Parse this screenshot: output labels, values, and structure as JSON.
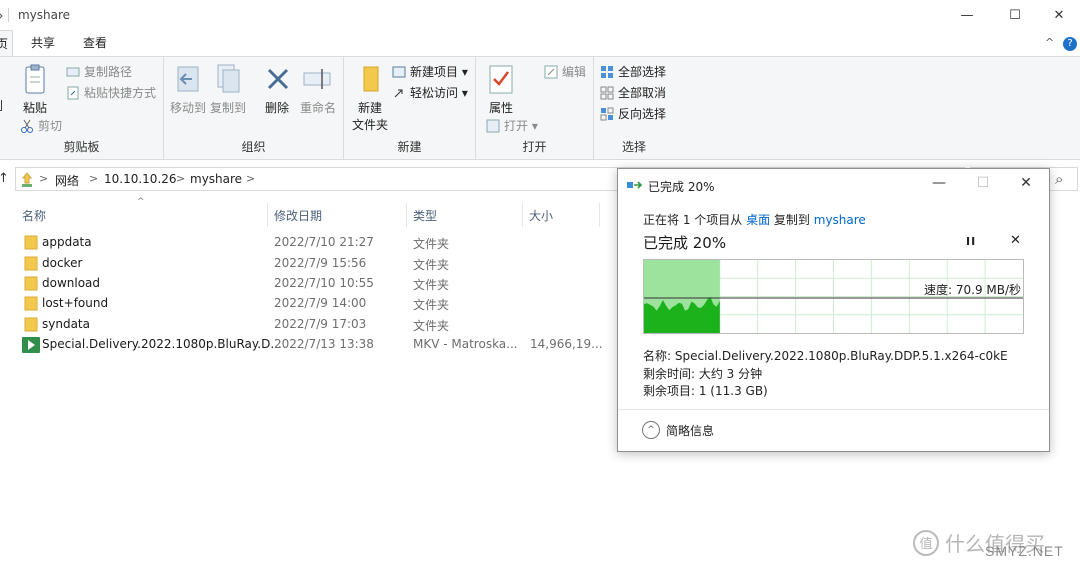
{
  "window": {
    "title": "myshare",
    "min": "—",
    "max": "☐",
    "close": "✕"
  },
  "tabs": {
    "file": "页",
    "share": "共享",
    "view": "查看",
    "collapse": "^",
    "help": "?"
  },
  "ribbon": {
    "clipboard": {
      "label": "剪贴板",
      "pin": "到",
      "paste": "粘贴",
      "copy_path": "复制路径",
      "paste_shortcut": "粘贴快捷方式",
      "cut": "剪切"
    },
    "organize": {
      "label": "组织",
      "move_to": "移动到",
      "copy_to": "复制到",
      "delete": "删除",
      "rename": "重命名"
    },
    "new": {
      "label": "新建",
      "new_folder_l1": "新建",
      "new_folder_l2": "文件夹",
      "new_item": "新建项目 ▾",
      "easy_access": "轻松访问 ▾"
    },
    "open": {
      "label": "打开",
      "properties": "属性",
      "open": "打开 ▾",
      "edit": "编辑"
    },
    "select": {
      "label": "选择",
      "select_all": "全部选择",
      "select_none": "全部取消",
      "invert": "反向选择"
    }
  },
  "address": {
    "up": "↑",
    "crumbs": [
      "网络",
      "10.10.10.26",
      "myshare"
    ],
    "chevrons": [
      ">",
      ">",
      ">",
      ">"
    ],
    "search_icon": "⌕"
  },
  "columns": {
    "name": "名称",
    "date": "修改日期",
    "type": "类型",
    "size": "大小",
    "sort": "^"
  },
  "files": [
    {
      "name": "appdata",
      "date": "2022/7/10 21:27",
      "type": "文件夹",
      "size": "",
      "icon": "folder-icon"
    },
    {
      "name": "docker",
      "date": "2022/7/9 15:56",
      "type": "文件夹",
      "size": "",
      "icon": "folder-icon"
    },
    {
      "name": "download",
      "date": "2022/7/10 10:55",
      "type": "文件夹",
      "size": "",
      "icon": "folder-icon"
    },
    {
      "name": "lost+found",
      "date": "2022/7/9 14:00",
      "type": "文件夹",
      "size": "",
      "icon": "folder-icon"
    },
    {
      "name": "syndata",
      "date": "2022/7/9 17:03",
      "type": "文件夹",
      "size": "",
      "icon": "folder-icon"
    },
    {
      "name": "Special.Delivery.2022.1080p.BluRay.D...",
      "date": "2022/7/13 13:38",
      "type": "MKV - Matroska...",
      "size": "14,966,19...",
      "icon": "mkv-file-icon"
    }
  ],
  "dialog": {
    "title": "已完成 20%",
    "min": "—",
    "max": "☐",
    "close": "✕",
    "line_prefix": "正在将 1 个项目从 ",
    "source": "桌面",
    "line_mid": " 复制到 ",
    "dest": "myshare",
    "progress_text": "已完成 20%",
    "progress_fraction": 0.2,
    "pause": "II",
    "cancel": "✕",
    "speed": "速度: 70.9 MB/秒",
    "name": "名称: Special.Delivery.2022.1080p.BluRay.DDP.5.1.x264-c0kE",
    "time_left": "剩余时间: 大约 3 分钟",
    "items_left": "剩余项目: 1 (11.3 GB)",
    "more_info": "简略信息",
    "more_icon": "^"
  },
  "watermark": {
    "icon_text": "值",
    "text": "什么值得买",
    "site": "SMYZ.NET"
  },
  "colors": {
    "accent": "#0066cc",
    "graph_fill": "#1bb21b",
    "graph_area": "#9de29d",
    "folder": "#f0c84a"
  }
}
